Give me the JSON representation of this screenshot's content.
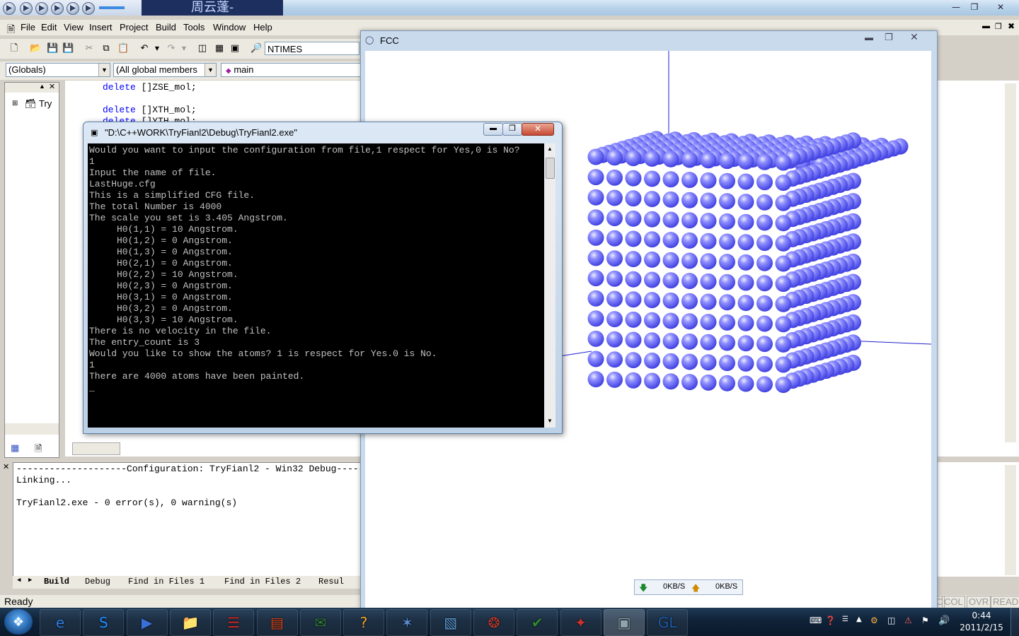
{
  "ide": {
    "title_ime": "周云蓬-",
    "menu": [
      "File",
      "Edit",
      "View",
      "Insert",
      "Project",
      "Build",
      "Tools",
      "Window",
      "Help"
    ],
    "find_text": "NTIMES",
    "wizard": {
      "class": "(Globals)",
      "members": "(All global members",
      "function": "main"
    },
    "workspace": {
      "tree_item": "Try"
    },
    "code_lines": [
      {
        "kw": "delete",
        "rest": " []ZSE_mol;"
      },
      {
        "kw": "delete",
        "rest": " []XTH_mol;"
      },
      {
        "kw": "delete",
        "rest": " []YTH_mol;"
      }
    ],
    "output_lines": [
      "--------------------Configuration: TryFianl2 - Win32 Debug--------------------",
      "Linking...",
      "",
      "TryFianl2.exe - 0 error(s), 0 warning(s)"
    ],
    "output_tabs": [
      "Build",
      "Debug",
      "Find in Files 1",
      "Find in Files 2",
      "Resul"
    ],
    "status": {
      "ready": "Ready",
      "col": "COL",
      "ovr": "OVR",
      "read": "READ",
      "c": "C"
    }
  },
  "fcc": {
    "title": "FCC",
    "net_down": "0KB/S",
    "net_up": "0KB/S",
    "sphere_color": "#8080ff"
  },
  "console": {
    "title": "\"D:\\C++WORK\\TryFianl2\\Debug\\TryFianl2.exe\"",
    "lines": [
      "Would you want to input the configuration from file,1 respect for Yes,0 is No?",
      "1",
      "Input the name of file.",
      "LastHuge.cfg",
      "This is a simplified CFG file.",
      "The total Number is 4000",
      "The scale you set is 3.405 Angstrom.",
      "     H0(1,1) = 10 Angstrom.",
      "     H0(1,2) = 0 Angstrom.",
      "     H0(1,3) = 0 Angstrom.",
      "     H0(2,1) = 0 Angstrom.",
      "     H0(2,2) = 10 Angstrom.",
      "     H0(2,3) = 0 Angstrom.",
      "     H0(3,1) = 0 Angstrom.",
      "     H0(3,2) = 0 Angstrom.",
      "     H0(3,3) = 10 Angstrom.",
      "There is no velocity in the file.",
      "The entry_count is 3",
      "Would you like to show the atoms? 1 is respect for Yes.0 is No.",
      "1",
      "There are 4000 atoms have been painted.",
      "_"
    ]
  },
  "taskbar": {
    "time": "0:44",
    "date": "2011/2/15",
    "apps": [
      "ie-icon",
      "skype-icon",
      "media-player-icon",
      "explorer-icon",
      "pdf-icon",
      "presentation-icon",
      "gtalk-icon",
      "help-icon",
      "app-icon",
      "notepad-icon",
      "game-icon",
      "vuze-icon",
      "rubik-icon",
      "console-icon",
      "opengl-icon"
    ]
  }
}
